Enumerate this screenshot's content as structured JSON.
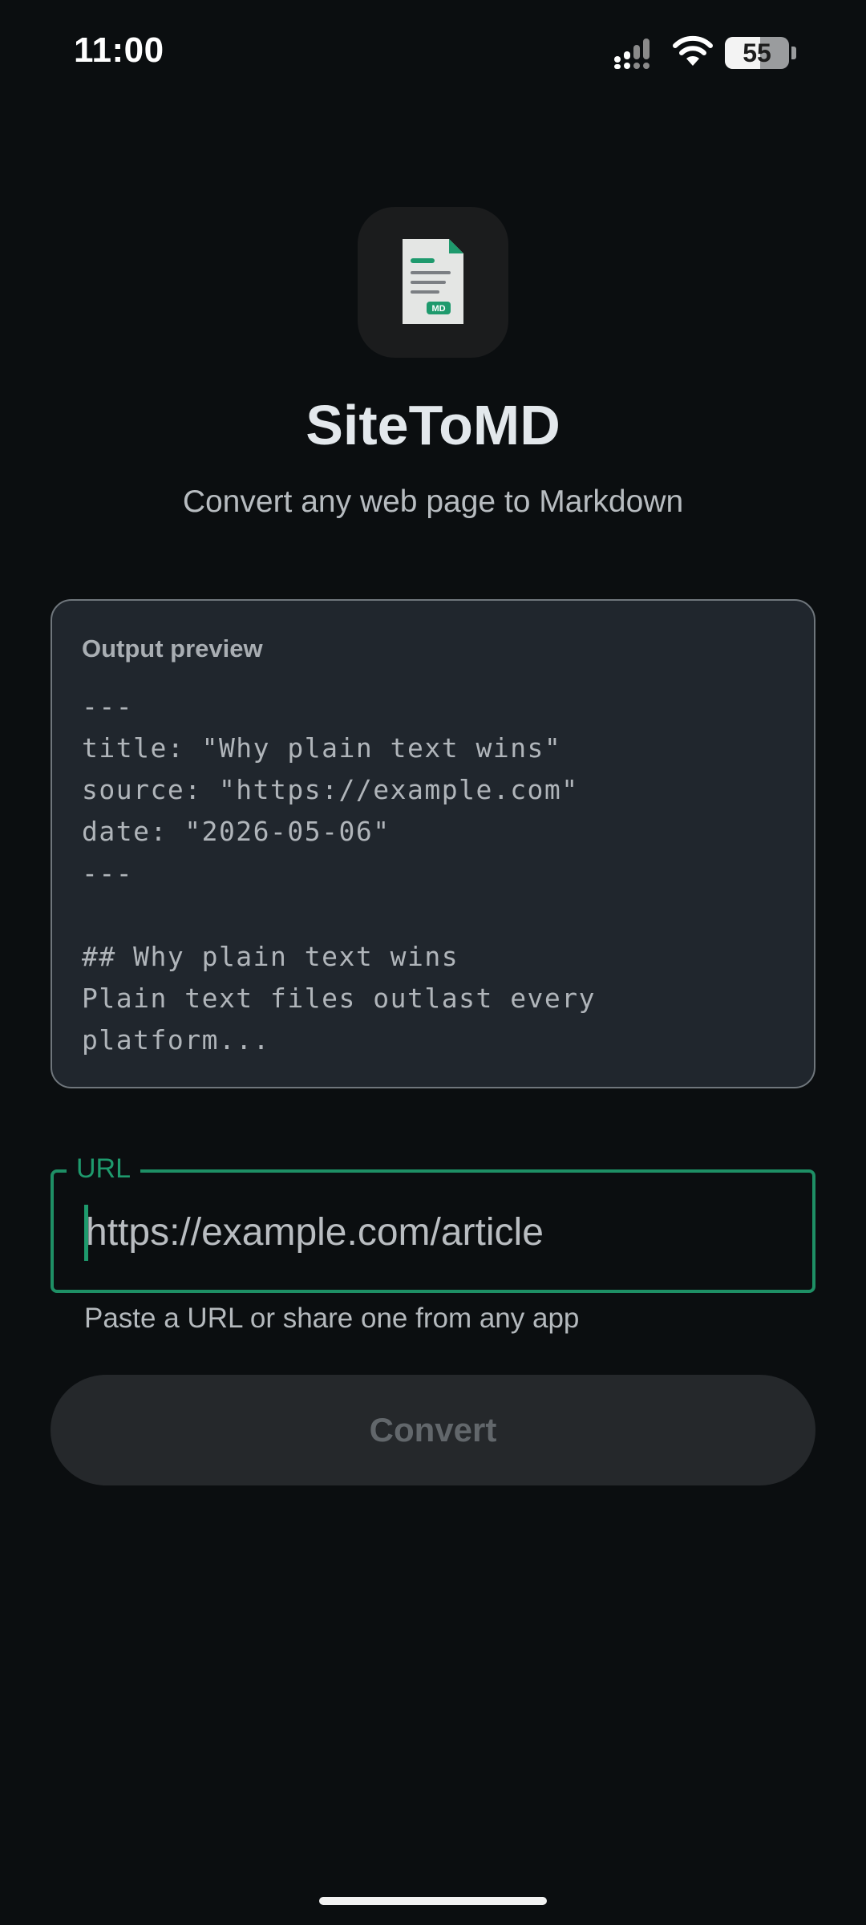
{
  "status_bar": {
    "time": "11:00",
    "battery_level": "55",
    "battery_fraction": 0.55,
    "icons": [
      "signal-icon",
      "wifi-icon",
      "battery-icon"
    ]
  },
  "app": {
    "icon": "markdown-document-icon",
    "icon_badge": "MD",
    "title": "SiteToMD",
    "subtitle": "Convert any web page to Markdown"
  },
  "preview": {
    "label": "Output preview",
    "lines": [
      "---",
      "title: \"Why plain text wins\"",
      "source: \"https://example.com\"",
      "date: \"2026-05-06\"",
      "---",
      "",
      "## Why plain text wins",
      "Plain text files outlast every",
      "platform..."
    ]
  },
  "url_field": {
    "label": "URL",
    "value": "",
    "placeholder": "https://example.com/article",
    "helper": "Paste a URL or share one from any app"
  },
  "convert_button": {
    "label": "Convert",
    "enabled": false
  },
  "colors": {
    "background": "#0b0e10",
    "accent": "#1e9a6d",
    "card": "#20262d",
    "button_disabled": "#25282b"
  }
}
